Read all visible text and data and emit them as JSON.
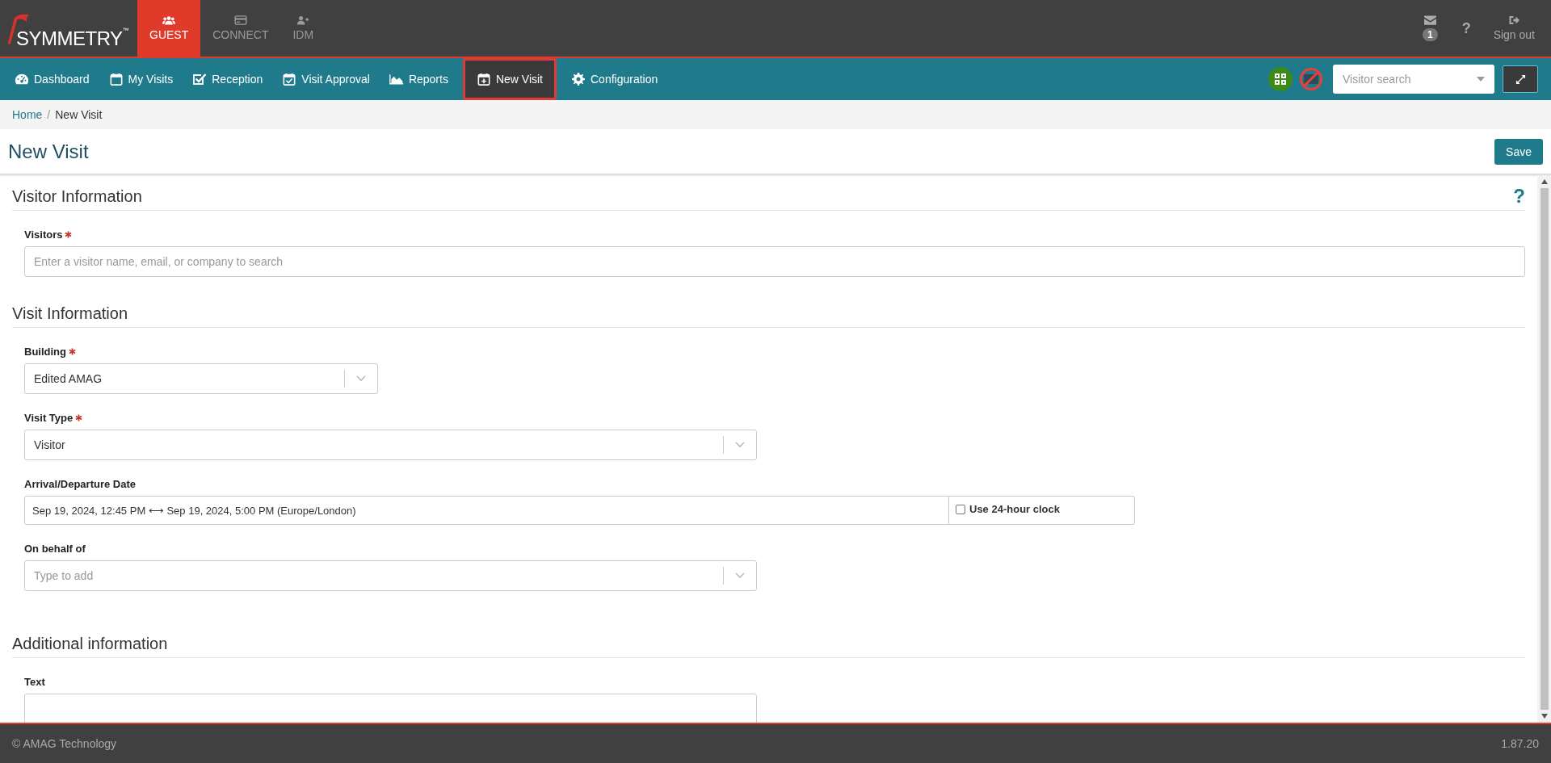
{
  "header": {
    "logo": "SYMMETRY",
    "logo_mark": "™",
    "modules": [
      {
        "label": "GUEST",
        "selected": true
      },
      {
        "label": "CONNECT",
        "selected": false
      },
      {
        "label": "IDM",
        "selected": false
      }
    ],
    "messages_badge": "1",
    "help": "?",
    "sign_out": "Sign out"
  },
  "nav": {
    "items": [
      {
        "label": "Dashboard",
        "selected": false
      },
      {
        "label": "My Visits",
        "selected": false
      },
      {
        "label": "Reception",
        "selected": false
      },
      {
        "label": "Visit Approval",
        "selected": false
      },
      {
        "label": "Reports",
        "selected": false
      },
      {
        "label": "New Visit",
        "selected": true
      },
      {
        "label": "Configuration",
        "selected": false
      }
    ],
    "visitor_search": {
      "placeholder": "Visitor search"
    }
  },
  "breadcrumb": [
    {
      "label": "Home",
      "separator": "/"
    },
    {
      "label": "New Visit"
    }
  ],
  "page": {
    "title": "New Visit",
    "save": "Save"
  },
  "sections": [
    {
      "title": "Visitor Information",
      "help": "?",
      "fields": [
        {
          "kind": "search",
          "label": "Visitors",
          "required": true,
          "placeholder": "Enter a visitor name, email, or company to search"
        }
      ]
    },
    {
      "title": "Visit Information",
      "fields": [
        {
          "kind": "select",
          "label": "Building",
          "required": true,
          "value": "Edited AMAG"
        },
        {
          "kind": "select",
          "label": "Visit Type",
          "required": true,
          "value": "Visitor"
        },
        {
          "kind": "daterange",
          "label": "Arrival/Departure Date",
          "required": false,
          "value": "Sep 19, 2024, 12:45 PM ⟷ Sep 19, 2024, 5:00 PM (Europe/London)",
          "option": {
            "label": "Use 24-hour clock",
            "checked": false
          }
        },
        {
          "kind": "select",
          "label": "On behalf of",
          "required": false,
          "placeholder": "Type to add"
        }
      ]
    },
    {
      "title": "Additional information",
      "fields": [
        {
          "kind": "text",
          "label": "Text",
          "required": false
        }
      ]
    }
  ],
  "footer": {
    "copyright": "© AMAG Technology",
    "version": "1.87.20"
  }
}
